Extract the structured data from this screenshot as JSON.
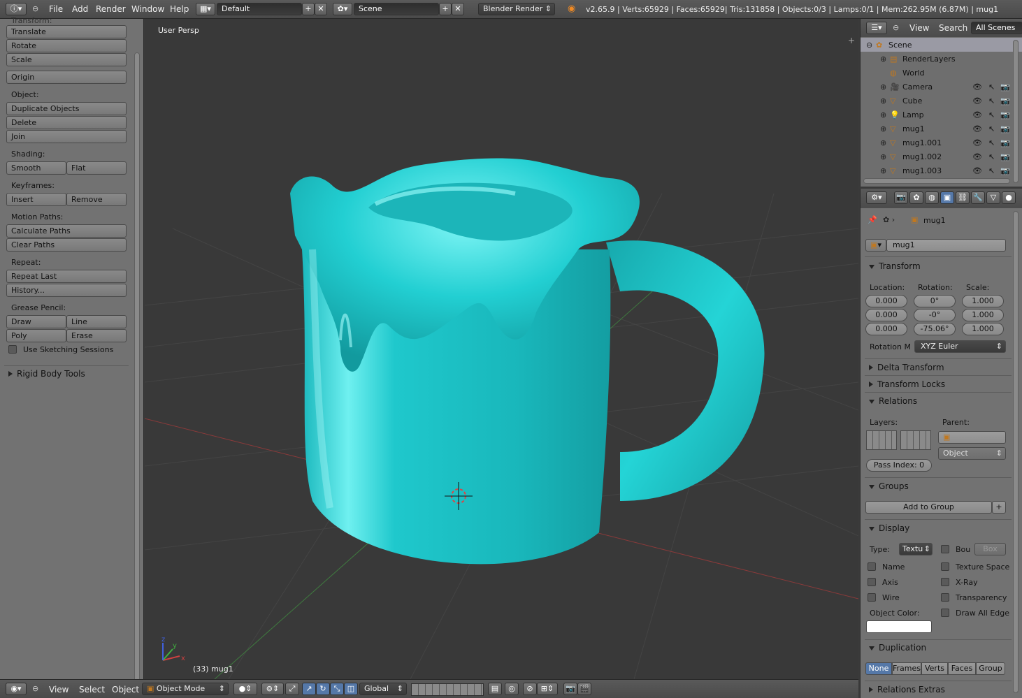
{
  "topbar": {
    "menus": [
      "File",
      "Add",
      "Render",
      "Window",
      "Help"
    ],
    "layout": "Default",
    "scene": "Scene",
    "engine": "Blender Render",
    "stats": "v2.65.9 | Verts:65929 | Faces:65929| Tris:131858 | Objects:0/3 | Lamps:0/1 | Mem:262.95M (6.87M) | mug1"
  },
  "toolshelf": {
    "cut_label": "Transform:",
    "transform": [
      "Translate",
      "Rotate",
      "Scale"
    ],
    "origin": "Origin",
    "object_label": "Object:",
    "object_ops": [
      "Duplicate Objects",
      "Delete",
      "Join"
    ],
    "shading_label": "Shading:",
    "shading": [
      "Smooth",
      "Flat"
    ],
    "keyframes_label": "Keyframes:",
    "keyframes": [
      "Insert",
      "Remove"
    ],
    "motion_label": "Motion Paths:",
    "motion": [
      "Calculate Paths",
      "Clear Paths"
    ],
    "repeat_label": "Repeat:",
    "repeat": [
      "Repeat Last",
      "History..."
    ],
    "grease_label": "Grease Pencil:",
    "grease": [
      "Draw",
      "Line",
      "Poly",
      "Erase"
    ],
    "sketching": "Use Sketching Sessions",
    "rigid": "Rigid Body Tools"
  },
  "viewport": {
    "view_name": "User Persp",
    "frame_info": "(33) mug1",
    "mug_color": "#1fc8cc",
    "axes": {
      "x": "x",
      "y": "y",
      "z": "z"
    }
  },
  "outliner": {
    "menus": [
      "View",
      "Search"
    ],
    "filter": "All Scenes",
    "items": [
      {
        "label": "Scene",
        "icon": "scene-icon"
      },
      {
        "label": "RenderLayers",
        "icon": "renderlayers-icon"
      },
      {
        "label": "World",
        "icon": "world-icon"
      },
      {
        "label": "Camera",
        "icon": "camera-icon"
      },
      {
        "label": "Cube",
        "icon": "mesh-icon"
      },
      {
        "label": "Lamp",
        "icon": "lamp-icon"
      },
      {
        "label": "mug1",
        "icon": "mesh-icon"
      },
      {
        "label": "mug1.001",
        "icon": "mesh-icon"
      },
      {
        "label": "mug1.002",
        "icon": "mesh-icon"
      },
      {
        "label": "mug1.003",
        "icon": "mesh-icon"
      }
    ]
  },
  "properties": {
    "breadcrumb": "mug1",
    "object_name": "mug1",
    "transform": {
      "title": "Transform",
      "location_label": "Location:",
      "rotation_label": "Rotation:",
      "scale_label": "Scale:",
      "location": [
        "0.000",
        "0.000",
        "0.000"
      ],
      "rotation": [
        "0°",
        "-0°",
        "-75.06°"
      ],
      "scale": [
        "1.000",
        "1.000",
        "1.000"
      ],
      "rotation_mode_label": "Rotation M",
      "rotation_mode": "XYZ Euler"
    },
    "delta": "Delta Transform",
    "locks": "Transform Locks",
    "relations": {
      "title": "Relations",
      "layers_label": "Layers:",
      "parent_label": "Parent:",
      "parent_type": "Object",
      "pass_index": "Pass Index: 0"
    },
    "groups": {
      "title": "Groups",
      "add": "Add to Group"
    },
    "display": {
      "title": "Display",
      "type_label": "Type:",
      "type": "Textu",
      "bounds": "Bou",
      "bounds_type": "Box",
      "left": [
        "Name",
        "Axis",
        "Wire"
      ],
      "right": [
        "Texture Space",
        "X-Ray",
        "Transparency",
        "Draw All Edge"
      ],
      "color_label": "Object Color:"
    },
    "duplication": {
      "title": "Duplication",
      "options": [
        "None",
        "Frames",
        "Verts",
        "Faces",
        "Group"
      ]
    },
    "relations_extras": "Relations Extras"
  },
  "bottombar": {
    "menus": [
      "View",
      "Select",
      "Object"
    ],
    "mode": "Object Mode",
    "orientation": "Global"
  }
}
